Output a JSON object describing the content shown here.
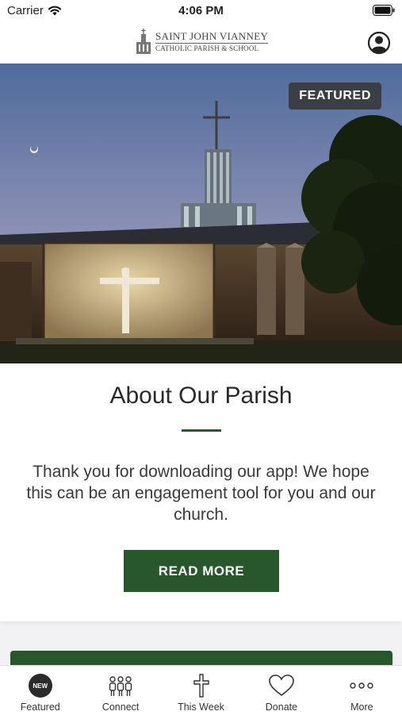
{
  "status_bar": {
    "carrier": "Carrier",
    "time": "4:06 PM"
  },
  "header": {
    "logo_line1": "SAINT JOHN VIANNEY",
    "logo_line2": "CATHOLIC PARISH & SCHOOL",
    "profile_icon": "person-circle-icon"
  },
  "hero": {
    "badge": "FEATURED"
  },
  "card": {
    "title": "About Our Parish",
    "body": "Thank you for downloading our app! We hope this can be an engagement tool for you and our church.",
    "button": "READ MORE"
  },
  "tabs": [
    {
      "label": "Featured",
      "icon": "new-badge-icon",
      "badge": "NEW"
    },
    {
      "label": "Connect",
      "icon": "people-icon"
    },
    {
      "label": "This Week",
      "icon": "cross-icon"
    },
    {
      "label": "Donate",
      "icon": "heart-icon"
    },
    {
      "label": "More",
      "icon": "more-dots-icon"
    }
  ],
  "colors": {
    "brand_green": "#27572a",
    "badge_bg": "#3a3f46"
  }
}
